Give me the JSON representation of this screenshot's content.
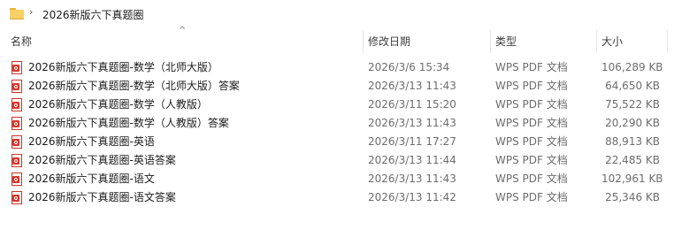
{
  "address": {
    "separator": "›",
    "path": "2026新版六下真题圈"
  },
  "columns": {
    "name": "名称",
    "date": "修改日期",
    "type": "类型",
    "size": "大小",
    "sort_indicator": "^"
  },
  "files": [
    {
      "name": "2026新版六下真题圈-数学（北师大版）",
      "date": "2026/3/6 15:34",
      "type": "WPS PDF 文档",
      "size": "106,289 KB"
    },
    {
      "name": "2026新版六下真题圈-数学（北师大版）答案",
      "date": "2026/3/13 11:43",
      "type": "WPS PDF 文档",
      "size": "64,650 KB"
    },
    {
      "name": "2026新版六下真题圈-数学（人教版）",
      "date": "2026/3/11 15:20",
      "type": "WPS PDF 文档",
      "size": "75,522 KB"
    },
    {
      "name": "2026新版六下真题圈-数学（人教版）答案",
      "date": "2026/3/13 11:43",
      "type": "WPS PDF 文档",
      "size": "20,290 KB"
    },
    {
      "name": "2026新版六下真题圈-英语",
      "date": "2026/3/11 17:27",
      "type": "WPS PDF 文档",
      "size": "88,913 KB"
    },
    {
      "name": "2026新版六下真题圈-英语答案",
      "date": "2026/3/13 11:44",
      "type": "WPS PDF 文档",
      "size": "22,485 KB"
    },
    {
      "name": "2026新版六下真题圈-语文",
      "date": "2026/3/13 11:43",
      "type": "WPS PDF 文档",
      "size": "102,961 KB"
    },
    {
      "name": "2026新版六下真题圈-语文答案",
      "date": "2026/3/13 11:42",
      "type": "WPS PDF 文档",
      "size": "25,346 KB"
    }
  ],
  "icons": {
    "folder": "folder-icon",
    "file": "pdf-file-icon"
  }
}
